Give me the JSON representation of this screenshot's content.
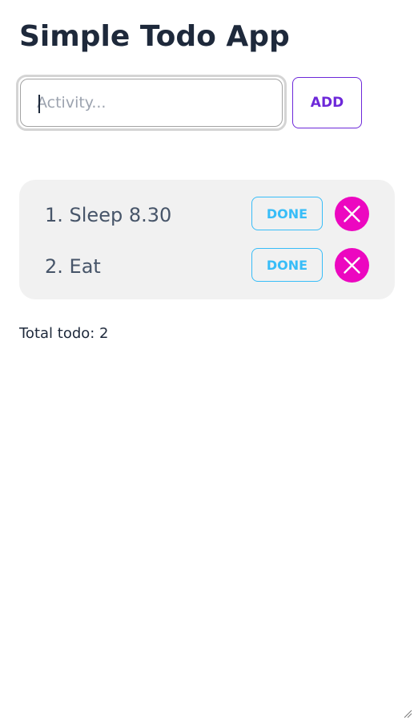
{
  "app": {
    "title": "Simple Todo App"
  },
  "form": {
    "input_value": "",
    "input_placeholder": "Activity...",
    "add_label": "ADD"
  },
  "todos": [
    {
      "text": "1. Sleep 8.30",
      "done_label": "DONE",
      "delete_icon": "close-icon"
    },
    {
      "text": "2. Eat",
      "done_label": "DONE",
      "delete_icon": "close-icon"
    }
  ],
  "footer": {
    "total_text": "Total todo: 2"
  },
  "colors": {
    "accent_purple": "#6d28d9",
    "done_blue": "#38bdf8",
    "delete_magenta": "#ec07c0",
    "list_background": "#f1f1f1",
    "title_text": "#1e293b"
  }
}
